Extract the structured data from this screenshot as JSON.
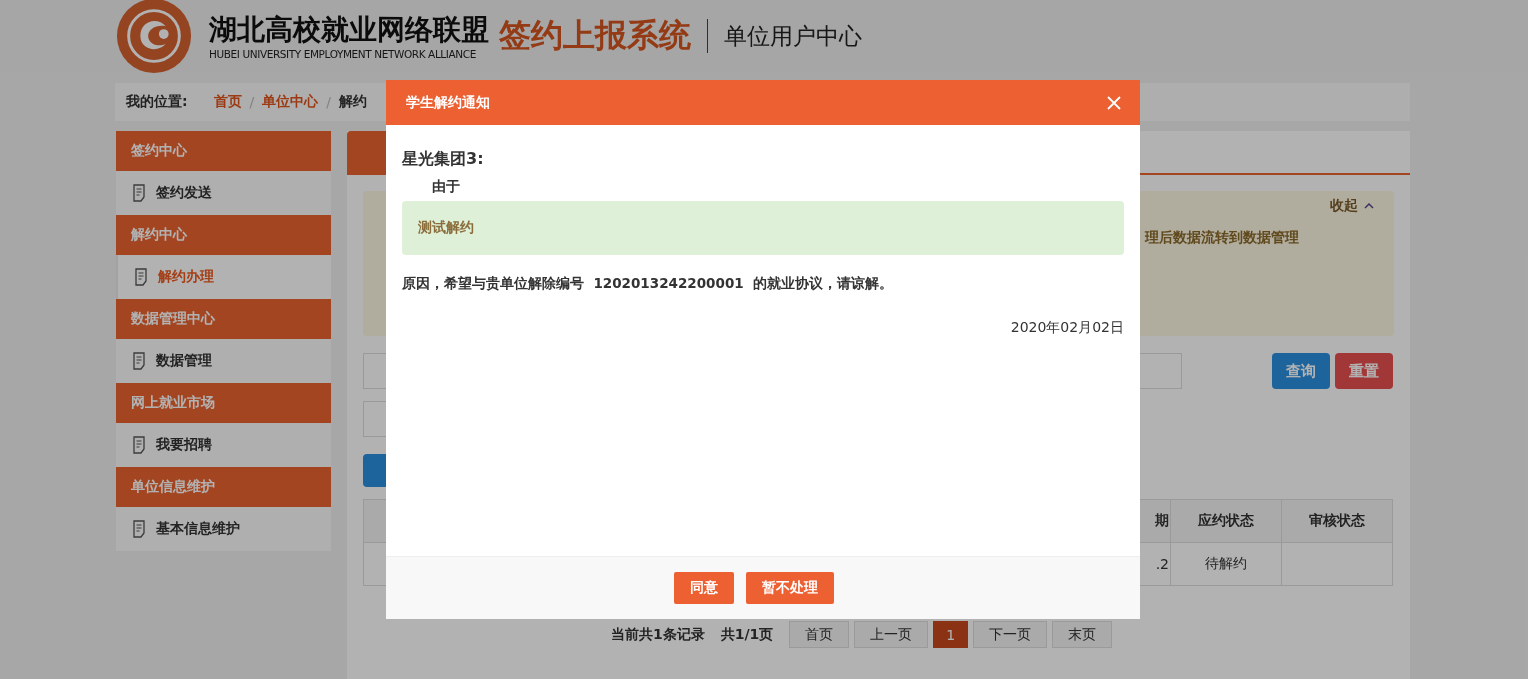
{
  "header": {
    "org_name": "湖北高校就业网络联盟",
    "org_name_en": "HUBEI UNIVERSITY EMPLOYMENT NETWORK ALLIANCE",
    "system_name": "签约上报系统",
    "center_name": "单位用户中心"
  },
  "breadcrumb": {
    "label": "我的位置:",
    "separator": "/",
    "items": [
      {
        "text": "首页",
        "kind": "link"
      },
      {
        "text": "单位中心",
        "kind": "link"
      },
      {
        "text": "解约",
        "kind": "current"
      }
    ]
  },
  "sidebar": [
    {
      "title": "签约中心",
      "items": [
        {
          "label": "签约发送",
          "selected": false
        }
      ]
    },
    {
      "title": "解约中心",
      "items": [
        {
          "label": "解约办理",
          "selected": true
        }
      ]
    },
    {
      "title": "数据管理中心",
      "items": [
        {
          "label": "数据管理",
          "selected": false
        }
      ]
    },
    {
      "title": "网上就业市场",
      "items": [
        {
          "label": "我要招聘",
          "selected": false
        }
      ]
    },
    {
      "title": "单位信息维护",
      "items": [
        {
          "label": "基本信息维护",
          "selected": false
        }
      ]
    }
  ],
  "notice": {
    "toggle": "收起",
    "line": "理后数据流转到数据管理"
  },
  "filter_buttons": [
    {
      "label": "查询",
      "kind": "primary"
    },
    {
      "label": "重置",
      "kind": "danger"
    }
  ],
  "table": {
    "columns": [
      "期",
      "应约状态",
      "审核状态"
    ],
    "rows": [
      [
        ".2",
        "待解约",
        ""
      ]
    ]
  },
  "pagination": {
    "summary": "当前共1条记录",
    "pages": "共1/1页",
    "buttons": [
      {
        "label": "首页",
        "selected": false
      },
      {
        "label": "上一页",
        "selected": false
      },
      {
        "label": "1",
        "selected": true
      },
      {
        "label": "下一页",
        "selected": false
      },
      {
        "label": "末页",
        "selected": false
      }
    ]
  },
  "dialog": {
    "title": "学生解约通知",
    "company": "星光集团3:",
    "intro": "由于",
    "reason": "测试解约",
    "message": "原因，希望与贵单位解除编号  1202013242200001  的就业协议，请谅解。",
    "date": "2020年02月02日",
    "buttons": [
      "同意",
      "暂不处理"
    ]
  }
}
